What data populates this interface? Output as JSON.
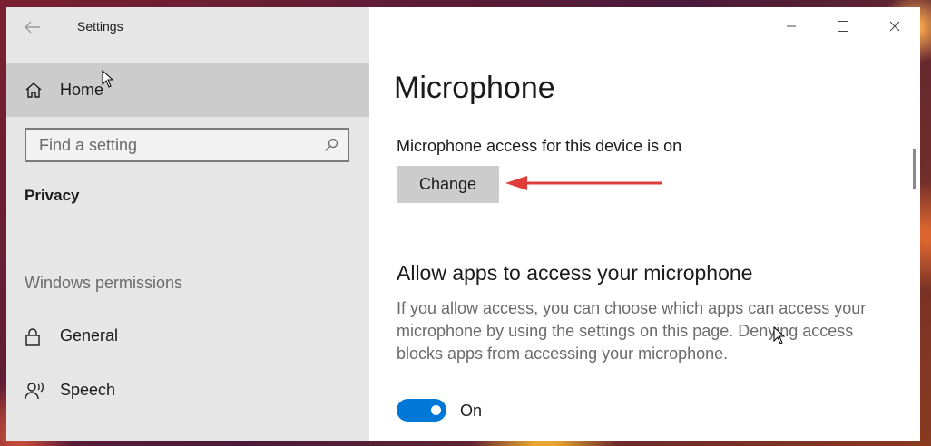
{
  "window": {
    "title": "Settings"
  },
  "sidebar": {
    "home_label": "Home",
    "search": {
      "placeholder": "Find a setting"
    },
    "section_title": "Privacy",
    "group_label": "Windows permissions",
    "items": [
      {
        "label": "General",
        "icon": "lock-icon"
      },
      {
        "label": "Speech",
        "icon": "speech-icon"
      }
    ]
  },
  "main": {
    "title": "Microphone",
    "access_status": "Microphone access for this device is on",
    "change_button": "Change",
    "section_heading": "Allow apps to access your microphone",
    "description": "If you allow access, you can choose which apps can access your microphone by using the settings on this page. Denying access blocks apps from accessing your microphone.",
    "toggle": {
      "state_label": "On",
      "on": true
    }
  },
  "colors": {
    "accent": "#0078d7",
    "annotation_arrow": "#e03c3c",
    "sidebar_bg": "#e6e6e6",
    "selected_bg": "#cccccc"
  }
}
